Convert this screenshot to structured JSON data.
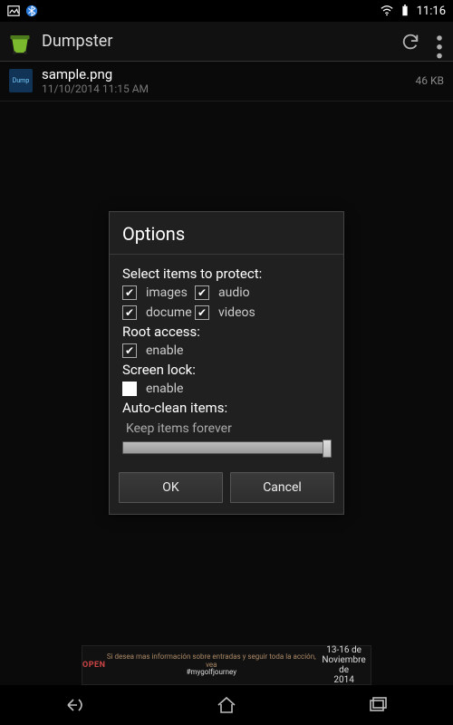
{
  "status": {
    "time": "11:16"
  },
  "app": {
    "title": "Dumpster"
  },
  "file": {
    "name": "sample.png",
    "date": "11/10/2014 11:15 AM",
    "size": "46 KB"
  },
  "dialog": {
    "title": "Options",
    "protect": {
      "label": "Select items to protect:",
      "images": "images",
      "audio": "audio",
      "documents": "docume",
      "videos": "videos"
    },
    "root": {
      "label": "Root access:",
      "enable": "enable"
    },
    "screenlock": {
      "label": "Screen lock:",
      "enable": "enable"
    },
    "autoclean": {
      "label": "Auto-clean items:",
      "value": "Keep items forever"
    },
    "ok": "OK",
    "cancel": "Cancel"
  },
  "ad": {
    "left": "OPEN",
    "mid": "Si desea mas información sobre entradas y seguir toda la acción, vea",
    "tag": "#mygolfjourney",
    "right_line1": "13-16 de",
    "right_line2": "Noviembre de",
    "right_line3": "2014"
  }
}
